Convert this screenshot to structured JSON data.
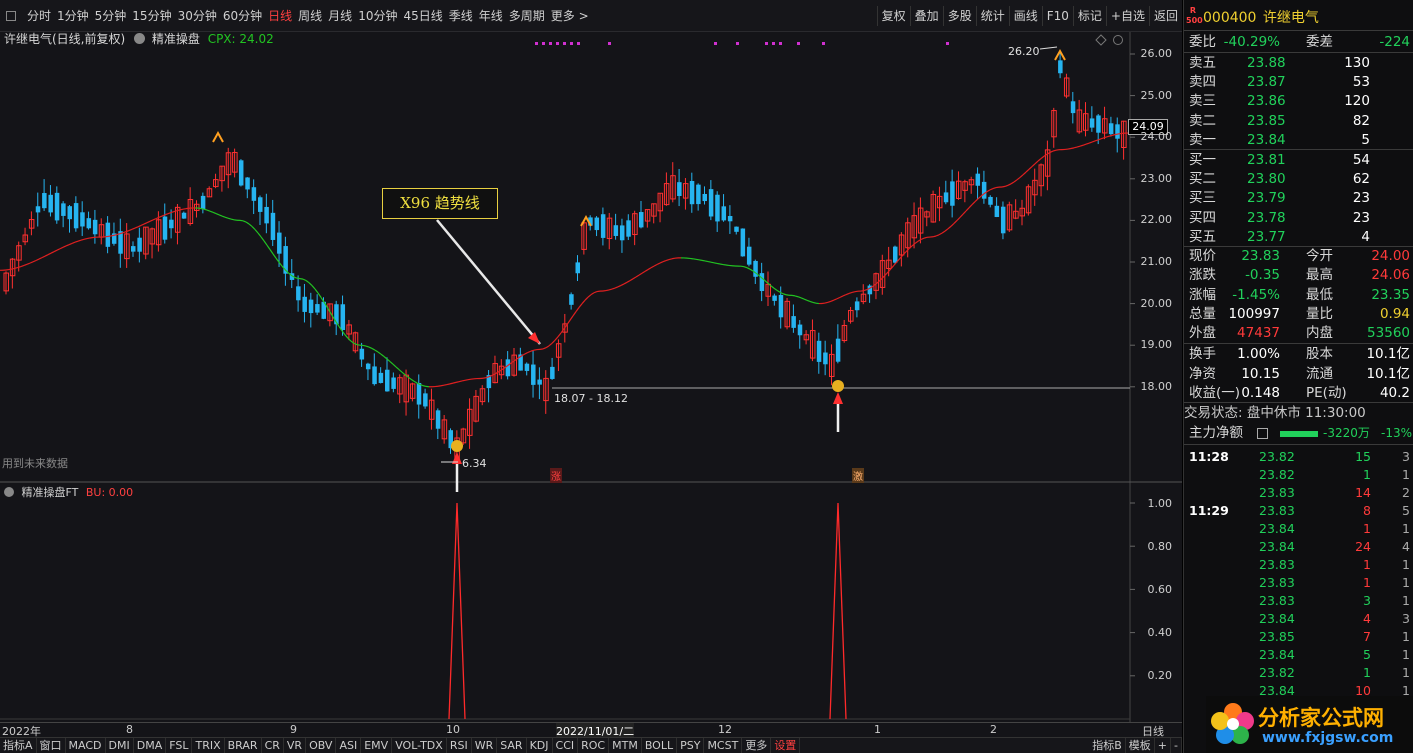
{
  "toolbar": {
    "periods": [
      "分时",
      "1分钟",
      "5分钟",
      "15分钟",
      "30分钟",
      "60分钟",
      "日线",
      "周线",
      "月线",
      "10分钟",
      "45日线",
      "季线",
      "年线",
      "多周期",
      "更多 >"
    ],
    "active": "日线",
    "right": [
      "复权",
      "叠加",
      "多股",
      "统计",
      "画线",
      "F10",
      "标记",
      "+自选",
      "返回"
    ]
  },
  "chart": {
    "title": "许继电气(日线,前复权)",
    "indicator": "精准操盘",
    "cpx_label": "CPX: 24.02",
    "annotation_box": "X96 趋势线",
    "future_data_label": "用到未来数据",
    "support_label": "18.07 - 18.12",
    "low_label": "6.34",
    "high_label": "26.20",
    "last_price_tag": "24.09",
    "zhang_label": "涨",
    "ji_label": "激",
    "price_ticks": [
      "26.00",
      "25.00",
      "24.00",
      "23.00",
      "22.00",
      "21.00",
      "20.00",
      "19.00",
      "18.00"
    ],
    "sub_title": "精准操盘FT",
    "sub_label": "BU: 0.00",
    "sub_ticks": [
      "1.00",
      "0.80",
      "0.60",
      "0.40",
      "0.20"
    ],
    "dates": [
      "2022年",
      "8",
      "9",
      "10",
      "2022/11/01/二",
      "12",
      "1",
      "2"
    ],
    "date_period": "日线",
    "colors": {
      "up": "#ff3030",
      "down": "#26b4f0",
      "ma_up": "#e02020",
      "ma_down": "#22c322",
      "bg": "#141418"
    }
  },
  "bottom": {
    "tabs": [
      "指标A",
      "窗口",
      "MACD",
      "DMI",
      "DMA",
      "FSL",
      "TRIX",
      "BRAR",
      "CR",
      "VR",
      "OBV",
      "ASI",
      "EMV",
      "VOL-TDX",
      "RSI",
      "WR",
      "SAR",
      "KDJ",
      "CCI",
      "ROC",
      "MTM",
      "BOLL",
      "PSY",
      "MCST",
      "更多",
      "设置"
    ],
    "right": [
      "指标B",
      "模板",
      "+",
      "-"
    ]
  },
  "quote": {
    "code": "000400",
    "name": "许继电气",
    "wb_label": "委比",
    "wb_value": "-40.29%",
    "wc_label": "委差",
    "wc_value": "-224",
    "asks": [
      {
        "label": "卖五",
        "price": "23.88",
        "vol": "130"
      },
      {
        "label": "卖四",
        "price": "23.87",
        "vol": "53"
      },
      {
        "label": "卖三",
        "price": "23.86",
        "vol": "120"
      },
      {
        "label": "卖二",
        "price": "23.85",
        "vol": "82"
      },
      {
        "label": "卖一",
        "price": "23.84",
        "vol": "5"
      }
    ],
    "bids": [
      {
        "label": "买一",
        "price": "23.81",
        "vol": "54"
      },
      {
        "label": "买二",
        "price": "23.80",
        "vol": "62"
      },
      {
        "label": "买三",
        "price": "23.79",
        "vol": "23"
      },
      {
        "label": "买四",
        "price": "23.78",
        "vol": "23"
      },
      {
        "label": "买五",
        "price": "23.77",
        "vol": "4"
      }
    ],
    "stats": [
      {
        "l1": "现价",
        "v1": "23.83",
        "c1": "g",
        "l2": "今开",
        "v2": "24.00",
        "c2": "r"
      },
      {
        "l1": "涨跌",
        "v1": "-0.35",
        "c1": "g",
        "l2": "最高",
        "v2": "24.06",
        "c2": "r"
      },
      {
        "l1": "涨幅",
        "v1": "-1.45%",
        "c1": "g",
        "l2": "最低",
        "v2": "23.35",
        "c2": "g"
      },
      {
        "l1": "总量",
        "v1": "100997",
        "c1": "w",
        "l2": "量比",
        "v2": "0.94",
        "c2": "y"
      },
      {
        "l1": "外盘",
        "v1": "47437",
        "c1": "r",
        "l2": "内盘",
        "v2": "53560",
        "c2": "g"
      },
      {
        "l1": "换手",
        "v1": "1.00%",
        "c1": "w",
        "l2": "股本",
        "v2": "10.1亿",
        "c2": "w"
      },
      {
        "l1": "净资",
        "v1": "10.15",
        "c1": "w",
        "l2": "流通",
        "v2": "10.1亿",
        "c2": "w"
      },
      {
        "l1": "收益(一)",
        "v1": "0.148",
        "c1": "w",
        "l2": "PE(动)",
        "v2": "40.2",
        "c2": "w"
      }
    ],
    "trade_status": "交易状态: 盘中休市 11:30:00",
    "main_net_label": "主力净额",
    "main_net_value": "-3220万",
    "main_net_pct": "-13%",
    "ticks": [
      {
        "t": "11:28",
        "p": "23.82",
        "v": "15",
        "n": "3",
        "vc": "g"
      },
      {
        "t": "",
        "p": "23.82",
        "v": "1",
        "n": "1",
        "vc": "g"
      },
      {
        "t": "",
        "p": "23.83",
        "v": "14",
        "n": "2",
        "vc": "r"
      },
      {
        "t": "11:29",
        "p": "23.83",
        "v": "8",
        "n": "5",
        "vc": "r"
      },
      {
        "t": "",
        "p": "23.84",
        "v": "1",
        "n": "1",
        "vc": "r"
      },
      {
        "t": "",
        "p": "23.84",
        "v": "24",
        "n": "4",
        "vc": "r"
      },
      {
        "t": "",
        "p": "23.83",
        "v": "1",
        "n": "1",
        "vc": "r"
      },
      {
        "t": "",
        "p": "23.83",
        "v": "1",
        "n": "1",
        "vc": "r"
      },
      {
        "t": "",
        "p": "23.83",
        "v": "3",
        "n": "1",
        "vc": "g"
      },
      {
        "t": "",
        "p": "23.84",
        "v": "4",
        "n": "3",
        "vc": "r"
      },
      {
        "t": "",
        "p": "23.85",
        "v": "7",
        "n": "1",
        "vc": "r"
      },
      {
        "t": "",
        "p": "23.84",
        "v": "5",
        "n": "1",
        "vc": "g"
      },
      {
        "t": "",
        "p": "23.82",
        "v": "1",
        "n": "1",
        "vc": "g"
      },
      {
        "t": "",
        "p": "23.84",
        "v": "10",
        "n": "1",
        "vc": "r"
      }
    ],
    "watermark_main": "分析家公式网",
    "watermark_sub": "www.fxjgsw.com"
  }
}
